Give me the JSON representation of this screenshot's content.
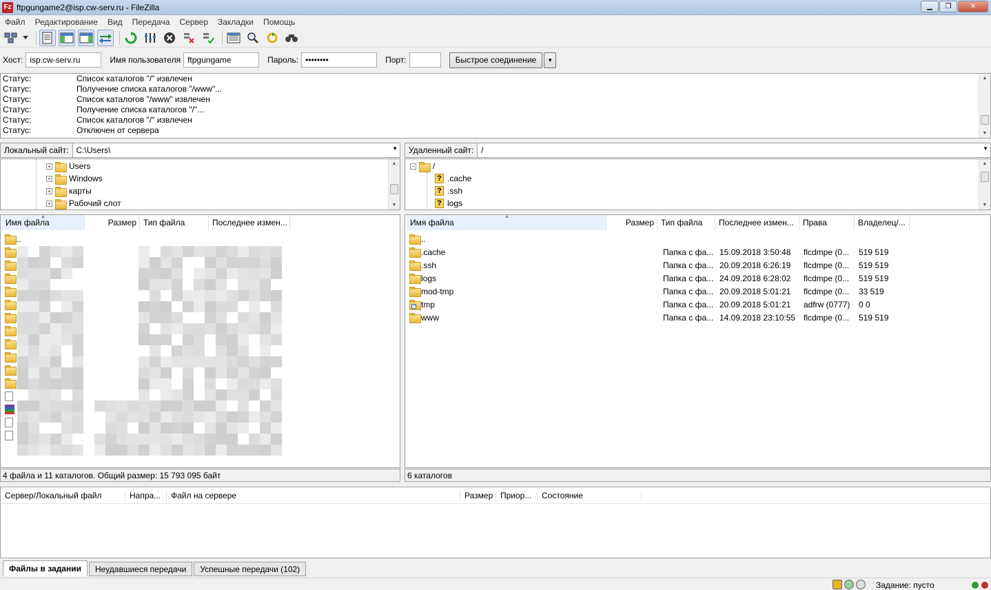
{
  "window": {
    "title": "ftpgungame2@isp.cw-serv.ru - FileZilla",
    "app_icon_letter": "Fz"
  },
  "menu": [
    "Файл",
    "Редактирование",
    "Вид",
    "Передача",
    "Сервер",
    "Закладки",
    "Помощь"
  ],
  "toolbar": {
    "icons": [
      "site-manager-icon",
      "dropdown-arrow-icon",
      "toggle-log-icon",
      "toggle-local-tree-icon",
      "toggle-remote-tree-icon",
      "toggle-queue-icon",
      "refresh-icon",
      "process-queue-icon",
      "cancel-icon",
      "disconnect-icon",
      "reconnect-icon",
      "directory-listing-filters-icon",
      "compare-directories-icon",
      "synchronized-browsing-icon",
      "search-icon"
    ]
  },
  "quickconnect": {
    "host_label": "Хост:",
    "host_value": "isp.cw-serv.ru",
    "user_label": "Имя пользователя",
    "user_value": "ftpgungame",
    "pass_label": "Пароль:",
    "pass_value": "••••••••",
    "port_label": "Порт:",
    "port_value": "",
    "button_label": "Быстрое соединение"
  },
  "log": [
    {
      "status": "Статус:",
      "message": "Список каталогов \"/\" извлечен"
    },
    {
      "status": "Статус:",
      "message": "Получение списка каталогов \"/www\"..."
    },
    {
      "status": "Статус:",
      "message": "Список каталогов \"/www\" извлечен"
    },
    {
      "status": "Статус:",
      "message": "Получение списка каталогов \"/\"..."
    },
    {
      "status": "Статус:",
      "message": "Список каталогов \"/\" извлечен"
    },
    {
      "status": "Статус:",
      "message": "Отключен от сервера"
    }
  ],
  "local": {
    "site_label": "Локальный сайт:",
    "path": "C:\\Users\\",
    "tree": [
      {
        "name": "Users",
        "expander": "+"
      },
      {
        "name": "Windows",
        "expander": "+"
      },
      {
        "name": "карты",
        "expander": "+"
      },
      {
        "name": "Рабочий слот",
        "expander": "+"
      }
    ],
    "columns": [
      "Имя файла",
      "Размер",
      "Тип файла",
      "Последнее измен..."
    ],
    "up_dir": "..",
    "status": "4 файла и 11 каталогов. Общий размер: 15 793 095 байт"
  },
  "remote": {
    "site_label": "Удаленный сайт:",
    "path": "/",
    "tree": [
      {
        "name": "/",
        "expander": "−",
        "type": "folder"
      },
      {
        "name": ".cache",
        "type": "unknown"
      },
      {
        "name": ".ssh",
        "type": "unknown"
      },
      {
        "name": "logs",
        "type": "unknown"
      }
    ],
    "columns": [
      "Имя файла",
      "Размер",
      "Тип файла",
      "Последнее измен...",
      "Права",
      "Владелец/..."
    ],
    "up_dir": "..",
    "files": [
      {
        "name": ".cache",
        "type": "Папка с фа...",
        "modified": "15.09.2018 3:50:48",
        "perms": "flcdmpe (0...",
        "owner": "519 519",
        "link": false
      },
      {
        "name": ".ssh",
        "type": "Папка с фа...",
        "modified": "20.09.2018 6:26:19",
        "perms": "flcdmpe (0...",
        "owner": "519 519",
        "link": false
      },
      {
        "name": "logs",
        "type": "Папка с фа...",
        "modified": "24.09.2018 6:28:02",
        "perms": "flcdmpe (0...",
        "owner": "519 519",
        "link": false
      },
      {
        "name": "mod-tmp",
        "type": "Папка с фа...",
        "modified": "20.09.2018 5:01:21",
        "perms": "flcdmpe (0...",
        "owner": "33 519",
        "link": false
      },
      {
        "name": "tmp",
        "type": "Папка с фа...",
        "modified": "20.09.2018 5:01:21",
        "perms": "adfrw (0777)",
        "owner": "0 0",
        "link": true
      },
      {
        "name": "www",
        "type": "Папка с фа...",
        "modified": "14.09.2018 23:10:55",
        "perms": "flcdmpe (0...",
        "owner": "519 519",
        "link": false
      }
    ],
    "status": "6 каталогов"
  },
  "queue": {
    "columns": [
      "Сервер/Локальный файл",
      "Напра...",
      "Файл на сервере",
      "Размер",
      "Приор...",
      "Состояние"
    ]
  },
  "tabs": [
    "Файлы в задании",
    "Неудавшиеся передачи",
    "Успешные передачи (102)"
  ],
  "statusbar": {
    "queue_text": "Задание: пусто"
  },
  "colors": {
    "led_green": "#2e9a2e",
    "led_red": "#c42b2b",
    "accent": "#3a6ea5"
  }
}
